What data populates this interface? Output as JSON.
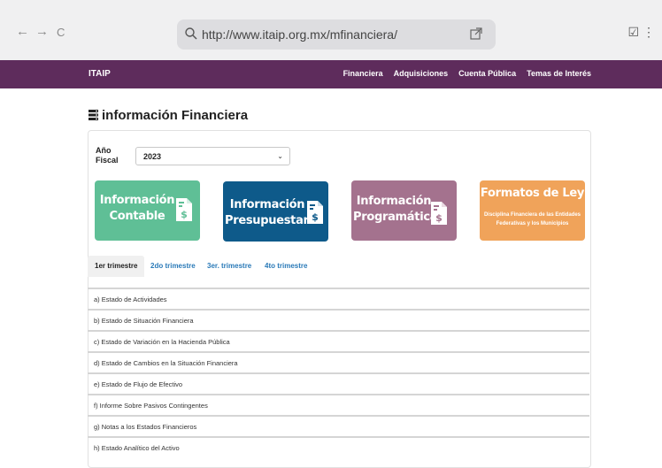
{
  "browser": {
    "back_glyph": "←",
    "forward_glyph": "→",
    "reload_glyph": "C",
    "url": "http://www.itaip.org.mx/mfinanciera/",
    "right_glyphs": "☑ ⋮",
    "icons": [
      "search-icon",
      "external-link-icon",
      "checkbox-icon",
      "kebab-menu-icon"
    ]
  },
  "site": {
    "brand": "ITAIP",
    "nav": [
      "Financiera",
      "Adquisiciones",
      "Cuenta Pública",
      "Temas de Interés"
    ],
    "header_color": "#5e2c5c"
  },
  "page": {
    "title": "información Financiera",
    "fiscal_label": "Año Fiscal",
    "fiscal_value": "2023"
  },
  "tiles": [
    {
      "title": "Información Contable",
      "line1": "Información",
      "line2": "Contable",
      "color": "#5fbf96"
    },
    {
      "title": "Información Presupuestaria",
      "line1": "Información",
      "line2": "Presupuestaria",
      "color": "#0e5a8a"
    },
    {
      "title": "Información Programática",
      "line1": "Información",
      "line2": "Programática",
      "color": "#a4728e"
    },
    {
      "title": "Formatos de Ley",
      "subtitle": "Disciplina Financiera de las Entidades Federativas y los Municipios",
      "color": "#f0a35a"
    }
  ],
  "tabs": [
    "1er trimestre",
    "2do trimestre",
    "3er. trimestre",
    "4to trimestre"
  ],
  "active_tab": "1er trimestre",
  "rows": [
    "a) Estado de Actividades",
    "b) Estado de Situación Financiera",
    "c) Estado de Variación en la Hacienda Pública",
    "d) Estado de Cambios en la Situación Financiera",
    "e) Estado de Flujo de Efectivo",
    "f) Informe Sobre Pasivos Contingentes",
    "g) Notas a los Estados Financieros",
    "h) Estado Analítico del Activo"
  ]
}
